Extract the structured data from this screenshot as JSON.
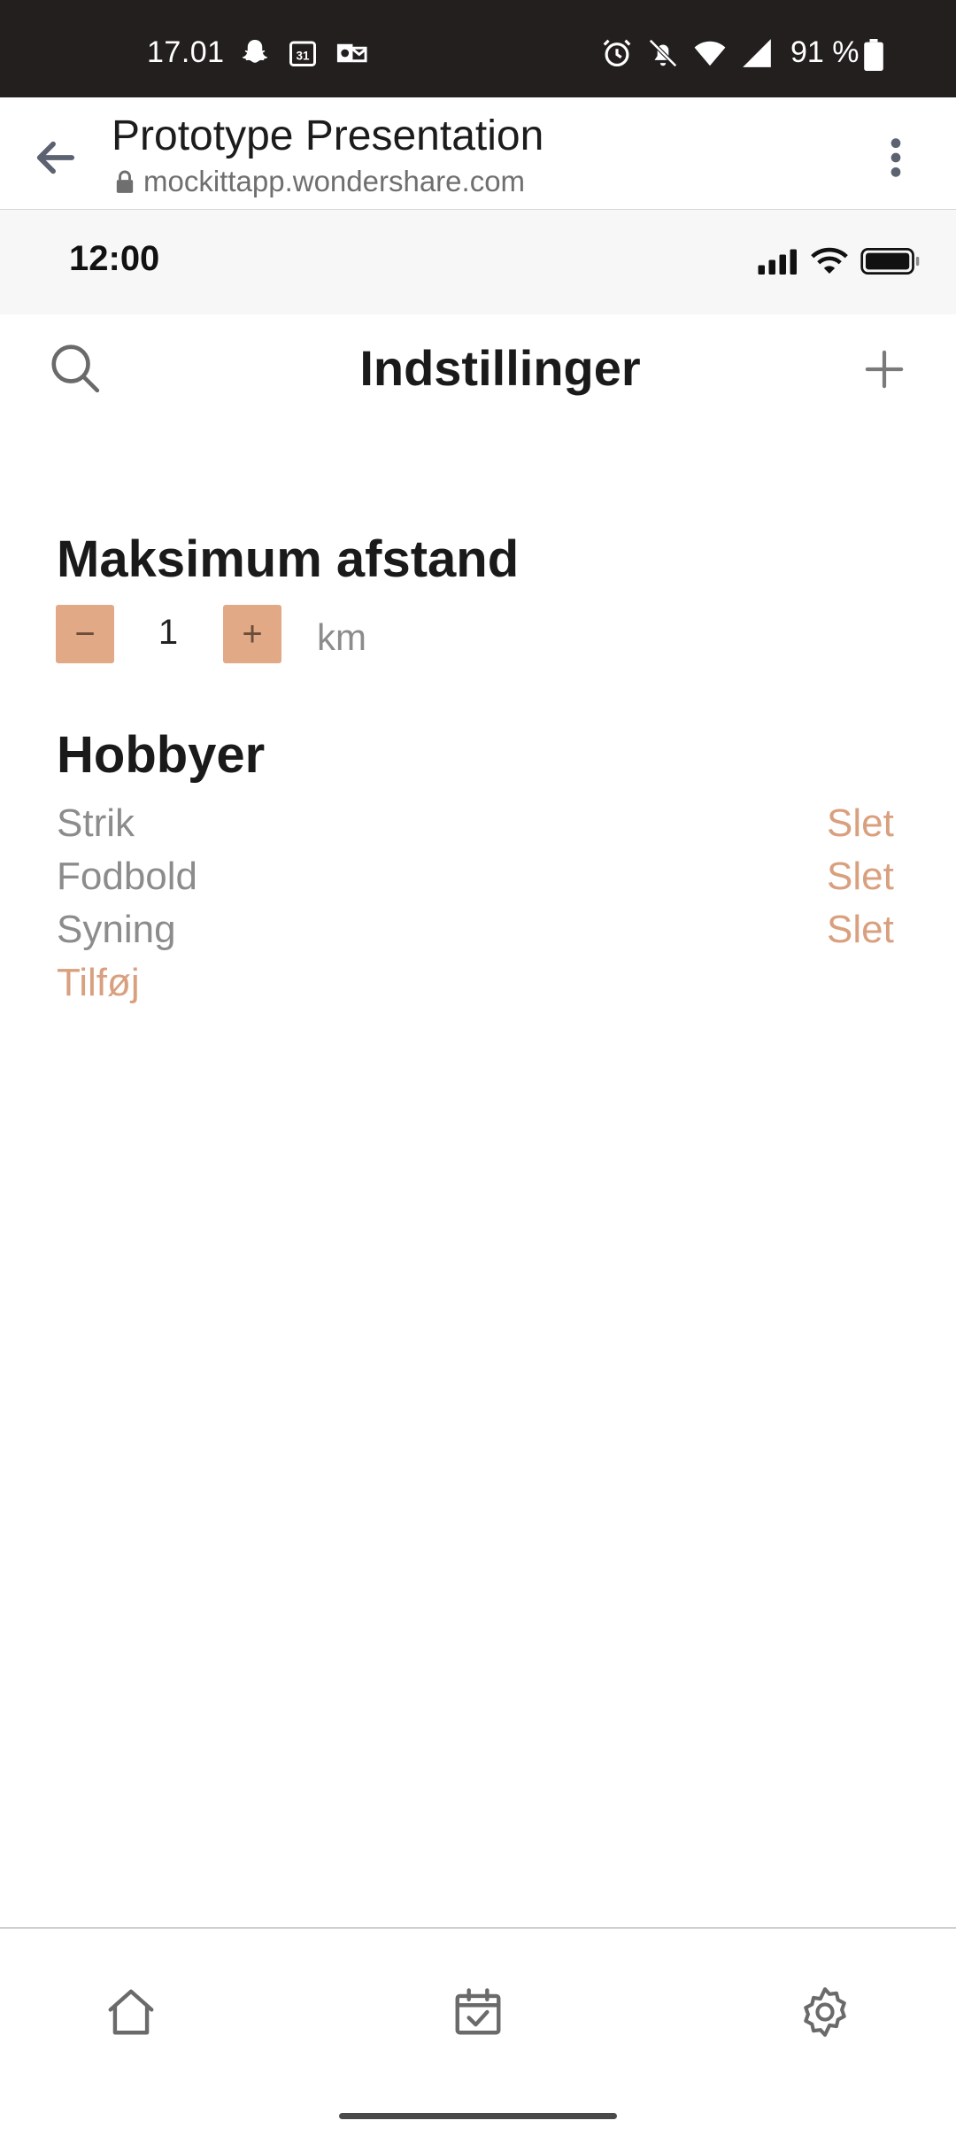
{
  "system_bar": {
    "time": "17.01",
    "battery_percent": "91 %",
    "left_icons": [
      "snapchat-icon",
      "calendar-31-icon",
      "outlook-icon"
    ],
    "right_icons": [
      "alarm-icon",
      "bell-off-icon",
      "wifi-icon",
      "signal-icon",
      "battery-icon"
    ]
  },
  "browser": {
    "title": "Prototype Presentation",
    "url": "mockittapp.wondershare.com"
  },
  "prototype_status": {
    "time": "12:00"
  },
  "header": {
    "title": "Indstillinger"
  },
  "distance": {
    "title": "Maksimum afstand",
    "value": "1",
    "unit": "km",
    "minus_label": "−",
    "plus_label": "+"
  },
  "hobbies": {
    "title": "Hobbyer",
    "items": [
      {
        "name": "Strik",
        "action": "Slet"
      },
      {
        "name": "Fodbold",
        "action": "Slet"
      },
      {
        "name": "Syning",
        "action": "Slet"
      }
    ],
    "add_label": "Tilføj"
  },
  "bottom_nav": {
    "items": [
      "home-icon",
      "calendar-check-icon",
      "settings-gear-icon"
    ]
  },
  "colors": {
    "accent": "#e2a987",
    "accent_text": "#d9a07f",
    "status_bar": "#231f1f"
  }
}
